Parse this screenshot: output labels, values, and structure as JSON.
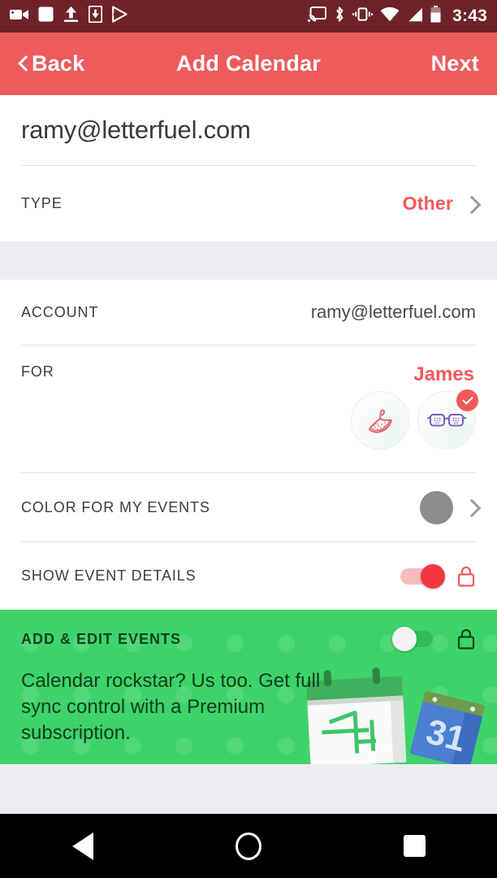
{
  "status_bar": {
    "time": "3:43",
    "left_icons": [
      "screen-record-icon",
      "stop-square-icon",
      "upload-icon",
      "download-to-device-icon",
      "play-store-icon"
    ],
    "right_icons": [
      "cast-icon",
      "bluetooth-icon",
      "vibrate-icon",
      "wifi-icon",
      "cell-signal-icon",
      "battery-icon"
    ],
    "background": "#6E2328"
  },
  "app_bar": {
    "back_label": "Back",
    "title": "Add Calendar",
    "next_label": "Next",
    "background": "#EC5C5C"
  },
  "header": {
    "email": "ramy@letterfuel.com"
  },
  "rows": {
    "type": {
      "label": "TYPE",
      "value": "Other",
      "value_color": "#F2585A"
    },
    "account": {
      "label": "ACCOUNT",
      "value": "ramy@letterfuel.com"
    },
    "for": {
      "label": "FOR",
      "selected_name": "James",
      "name_color": "#F2585A",
      "avatars": [
        {
          "icon": "watermelon-avatar-icon",
          "selected": false
        },
        {
          "icon": "sunglasses-avatar-icon",
          "selected": true
        }
      ]
    },
    "color": {
      "label": "COLOR FOR MY EVENTS",
      "swatch_color": "#8C8C8C"
    },
    "show_event_details": {
      "label": "SHOW EVENT DETAILS",
      "toggle_state": "on",
      "toggle_color": "#F2383F",
      "lock": "lock-icon"
    }
  },
  "promo": {
    "label": "ADD & EDIT EVENTS",
    "toggle_state": "off",
    "lock": "lock-icon",
    "message": "Calendar rockstar? Us too. Get full sync control with a Premium subscription.",
    "background": "#3ED36A",
    "art": [
      "desk-calendar-illustration",
      "google-calendar-31-illustration"
    ]
  },
  "nav_bar": {
    "buttons": [
      "back-nav-icon",
      "home-nav-icon",
      "recents-nav-icon"
    ]
  }
}
